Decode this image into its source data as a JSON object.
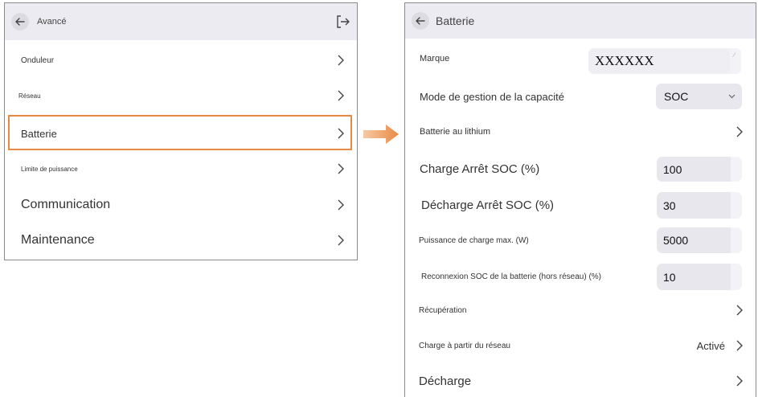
{
  "left": {
    "title": "Avancé",
    "items": [
      {
        "label": "Onduleur"
      },
      {
        "label": "Réseau"
      },
      {
        "label": "Batterie"
      },
      {
        "label": "Limite de puissance"
      },
      {
        "label": "Communication"
      },
      {
        "label": "Maintenance"
      }
    ]
  },
  "right": {
    "title": "Batterie",
    "brand": {
      "label": "Marque",
      "value": "XXXXXX"
    },
    "capacity_mode": {
      "label": "Mode de gestion de la capacité",
      "value": "SOC"
    },
    "lithium": {
      "label": "Batterie au lithium"
    },
    "charge_stop": {
      "label": "Charge Arrêt SOC (%)",
      "value": "100"
    },
    "discharge_stop": {
      "label": "Décharge Arrêt SOC (%)",
      "value": "30"
    },
    "max_charge": {
      "label": "Puissance de charge max. (W)",
      "value": "5000"
    },
    "reconnect": {
      "label": "Reconnexion SOC de la batterie (hors réseau) (%)",
      "value": "10"
    },
    "recovery": {
      "label": "Récupération"
    },
    "grid_charge": {
      "label": "Charge à partir du réseau",
      "value": "Activé"
    },
    "discharge": {
      "label": "Décharge"
    }
  },
  "colors": {
    "highlight": "#e98a44",
    "header": "#ecebf1",
    "input": "#e8e7ed"
  }
}
